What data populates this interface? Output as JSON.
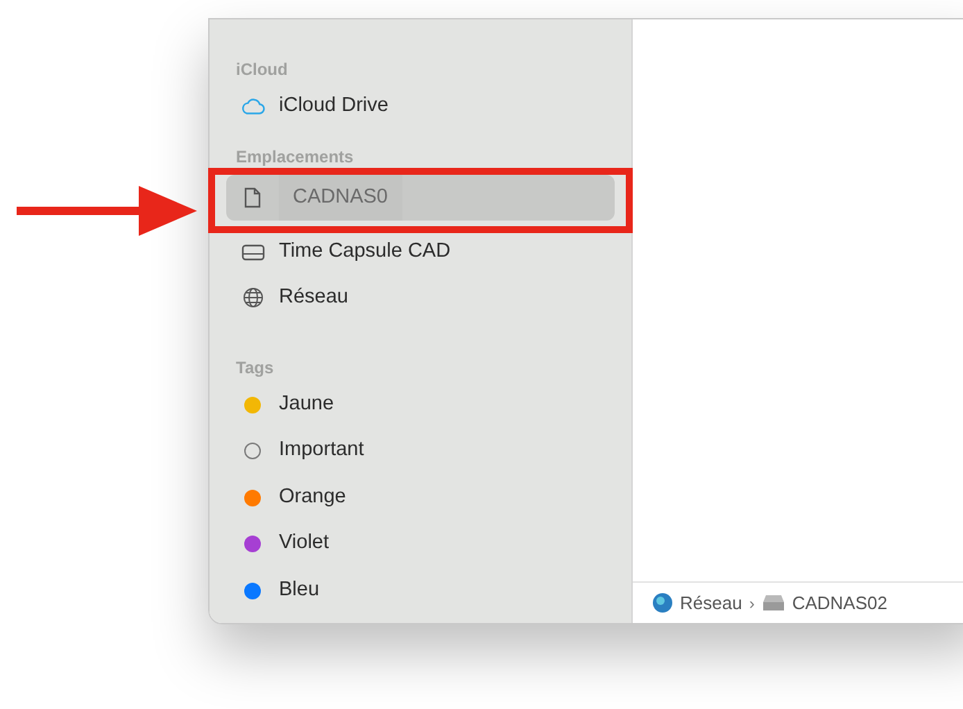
{
  "sidebar": {
    "sections": [
      {
        "title": "iCloud",
        "items": [
          {
            "label": "iCloud Drive",
            "kind": "cloud",
            "selected": false
          }
        ]
      },
      {
        "title": "Emplacements",
        "items": [
          {
            "label": "CADNAS0",
            "kind": "file",
            "selected": true
          },
          {
            "label": "Time Capsule CAD",
            "kind": "drive",
            "selected": false
          },
          {
            "label": "Réseau",
            "kind": "globe",
            "selected": false
          }
        ]
      },
      {
        "title": "Tags",
        "items": [
          {
            "label": "Jaune",
            "kind": "dot",
            "color": "#f2b705",
            "selected": false
          },
          {
            "label": "Important",
            "kind": "ring",
            "color": "#7a7a7a",
            "selected": false
          },
          {
            "label": "Orange",
            "kind": "dot",
            "color": "#ff7a00",
            "selected": false
          },
          {
            "label": "Violet",
            "kind": "dot",
            "color": "#a63fd3",
            "selected": false
          },
          {
            "label": "Bleu",
            "kind": "dot",
            "color": "#0a78ff",
            "selected": false
          }
        ]
      }
    ]
  },
  "path_bar": {
    "separator": "›",
    "items": [
      {
        "label": "Réseau",
        "kind": "earth"
      },
      {
        "label": "CADNAS02",
        "kind": "server"
      }
    ]
  }
}
